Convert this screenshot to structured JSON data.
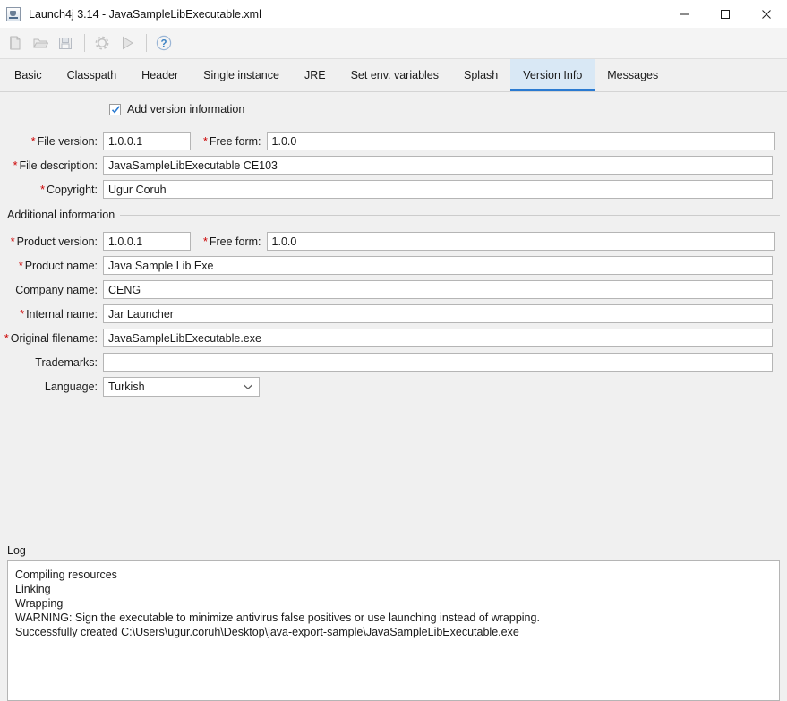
{
  "window": {
    "title": "Launch4j 3.14 - JavaSampleLibExecutable.xml",
    "icon": "java-app-icon",
    "minimize_label": "Minimize",
    "maximize_label": "Maximize",
    "close_label": "Close"
  },
  "toolbar": {
    "buttons": [
      {
        "name": "new-file-icon",
        "label": "New"
      },
      {
        "name": "open-file-icon",
        "label": "Open"
      },
      {
        "name": "save-file-icon",
        "label": "Save"
      },
      {
        "name": "build-settings-icon",
        "label": "Build wrapper"
      },
      {
        "name": "run-icon",
        "label": "Test wrapper"
      },
      {
        "name": "help-icon",
        "label": "Help"
      }
    ]
  },
  "tabs": [
    {
      "label": "Basic",
      "active": false
    },
    {
      "label": "Classpath",
      "active": false
    },
    {
      "label": "Header",
      "active": false
    },
    {
      "label": "Single instance",
      "active": false
    },
    {
      "label": "JRE",
      "active": false
    },
    {
      "label": "Set env. variables",
      "active": false
    },
    {
      "label": "Splash",
      "active": false
    },
    {
      "label": "Version Info",
      "active": true
    },
    {
      "label": "Messages",
      "active": false
    }
  ],
  "form": {
    "add_version_information": {
      "label": "Add version information",
      "checked": true
    },
    "file_version": {
      "label": "File version:",
      "required": true,
      "value": "1.0.0.1"
    },
    "file_version_free_form": {
      "label": "Free form:",
      "required": true,
      "value": "1.0.0"
    },
    "file_description": {
      "label": "File description:",
      "required": true,
      "value": "JavaSampleLibExecutable CE103"
    },
    "copyright": {
      "label": "Copyright:",
      "required": true,
      "value": "Ugur Coruh"
    },
    "additional_information_group": "Additional information",
    "product_version": {
      "label": "Product version:",
      "required": true,
      "value": "1.0.0.1"
    },
    "product_version_free_form": {
      "label": "Free form:",
      "required": true,
      "value": "1.0.0"
    },
    "product_name": {
      "label": "Product name:",
      "required": true,
      "value": "Java Sample Lib Exe"
    },
    "company_name": {
      "label": "Company name:",
      "required": false,
      "value": "CENG"
    },
    "internal_name": {
      "label": "Internal name:",
      "required": true,
      "value": "Jar Launcher"
    },
    "original_filename": {
      "label": "Original filename:",
      "required": true,
      "value": "JavaSampleLibExecutable.exe"
    },
    "trademarks": {
      "label": "Trademarks:",
      "required": false,
      "value": ""
    },
    "language": {
      "label": "Language:",
      "required": false,
      "value": "Turkish"
    }
  },
  "log": {
    "group_label": "Log",
    "lines": [
      "Compiling resources",
      "Linking",
      "Wrapping",
      "WARNING: Sign the executable to minimize antivirus false positives or use launching instead of wrapping.",
      "Successfully created C:\\Users\\ugur.coruh\\Desktop\\java-export-sample\\JavaSampleLibExecutable.exe"
    ]
  },
  "colors": {
    "accent": "#2a7ad1",
    "active_tab_bg": "#d9e8f5",
    "required_marker": "#cc0000",
    "window_bg": "#f0f0f0",
    "field_bg": "#ffffff"
  }
}
